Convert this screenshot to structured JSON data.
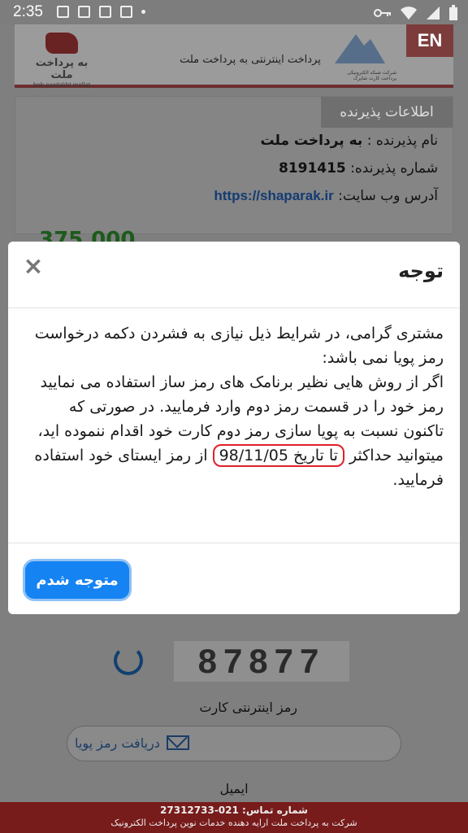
{
  "status_bar": {
    "time": "2:35"
  },
  "header": {
    "brand_logo_text": "به پرداخت ملت",
    "brand_logo_latin": "beh pardakht mellat",
    "center_title": "پرداخت اینترنتی به پرداخت ملت",
    "shaparak_caption": "شرکت شبکه الکترونیکی پرداخت کارت شاپرک",
    "lang_button": "EN"
  },
  "merchant": {
    "tab_label": "اطلاعات پذیرنده",
    "name_label": "نام پذیرنده :",
    "name_value": "به پرداخت ملت",
    "number_label": "شماره پذیرنده:",
    "number_value": "8191415",
    "website_label": "آدرس وب سایت:",
    "website_value": "https://shaparak.ir"
  },
  "amount": {
    "value": "375,000"
  },
  "form": {
    "captcha_text": "87877",
    "pin_label": "رمز اینترنتی کارت",
    "otp_button": "دریافت رمز پویا",
    "email_label": "ایمیل"
  },
  "footer": {
    "contact": "شماره تماس: 021-27312733",
    "company": "شرکت به پرداخت ملت ارایه دهنده خدمات نوین پرداخت الکترونیک"
  },
  "modal": {
    "title": "توجه",
    "close_symbol": "×",
    "paragraph1": "مشتری گرامی، در شرایط ذیل نیازی به فشردن دکمه درخواست رمز پویا نمی باشد:",
    "paragraph2_before": "اگر از روش هایی نظیر برنامک های رمز ساز استفاده می نمایید رمز خود را در قسمت رمز دوم وارد فرمایید. در صورتی که تاکنون نسبت به پویا سازی رمز دوم کارت خود اقدام ننموده اید، میتوانید حداکثر",
    "paragraph2_highlight": "تا تاریخ 98/11/05",
    "paragraph2_after": "از رمز ایستای خود استفاده فرمایید.",
    "ok_button": "متوجه شدم"
  }
}
